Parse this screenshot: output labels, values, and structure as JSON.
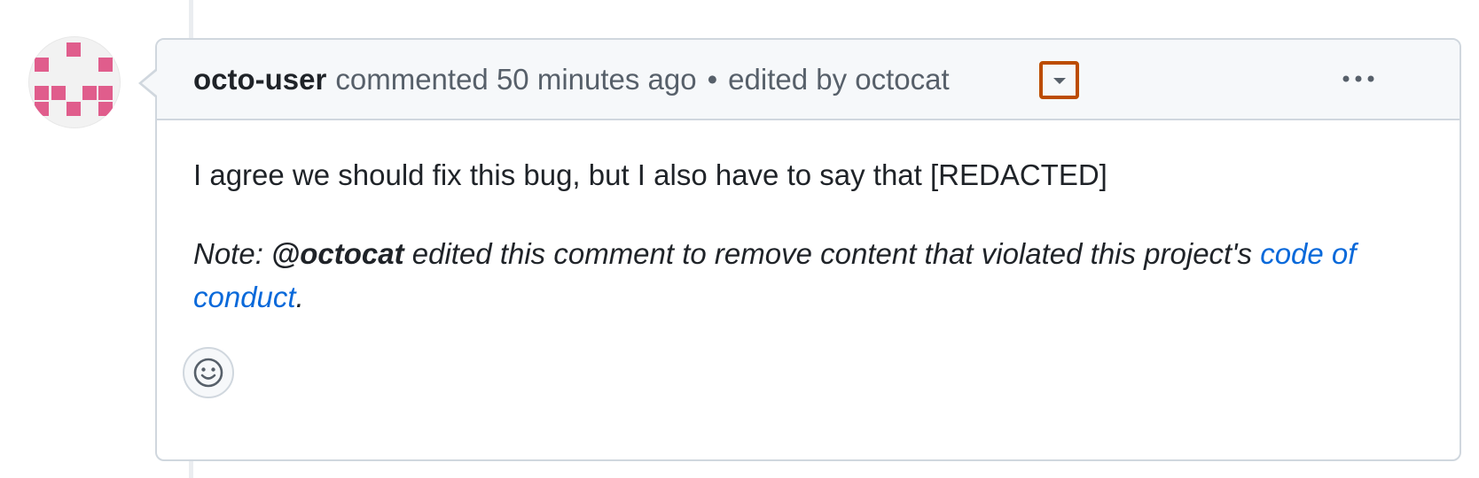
{
  "comment": {
    "author": "octo-user",
    "action": "commented",
    "time": "50 minutes ago",
    "separator": "•",
    "edited_by": "edited by octocat",
    "body_line1": "I agree we should fix this bug, but I also have to say that [REDACTED]",
    "note_prefix": "Note: ",
    "note_mention": "@octocat",
    "note_text": " edited this comment to remove content that violated this project's ",
    "note_link": "code of conduct",
    "note_suffix": "."
  },
  "icons": {
    "avatar": "identicon-avatar",
    "edit_history": "triangle-down-icon",
    "more": "kebab-horizontal-icon",
    "reaction": "smiley-icon"
  },
  "colors": {
    "identicon": "#e05d8c",
    "link": "#0969da",
    "highlight": "#bc4c00",
    "muted": "#57606a",
    "border": "#d0d7de",
    "header_bg": "#f6f8fa"
  }
}
